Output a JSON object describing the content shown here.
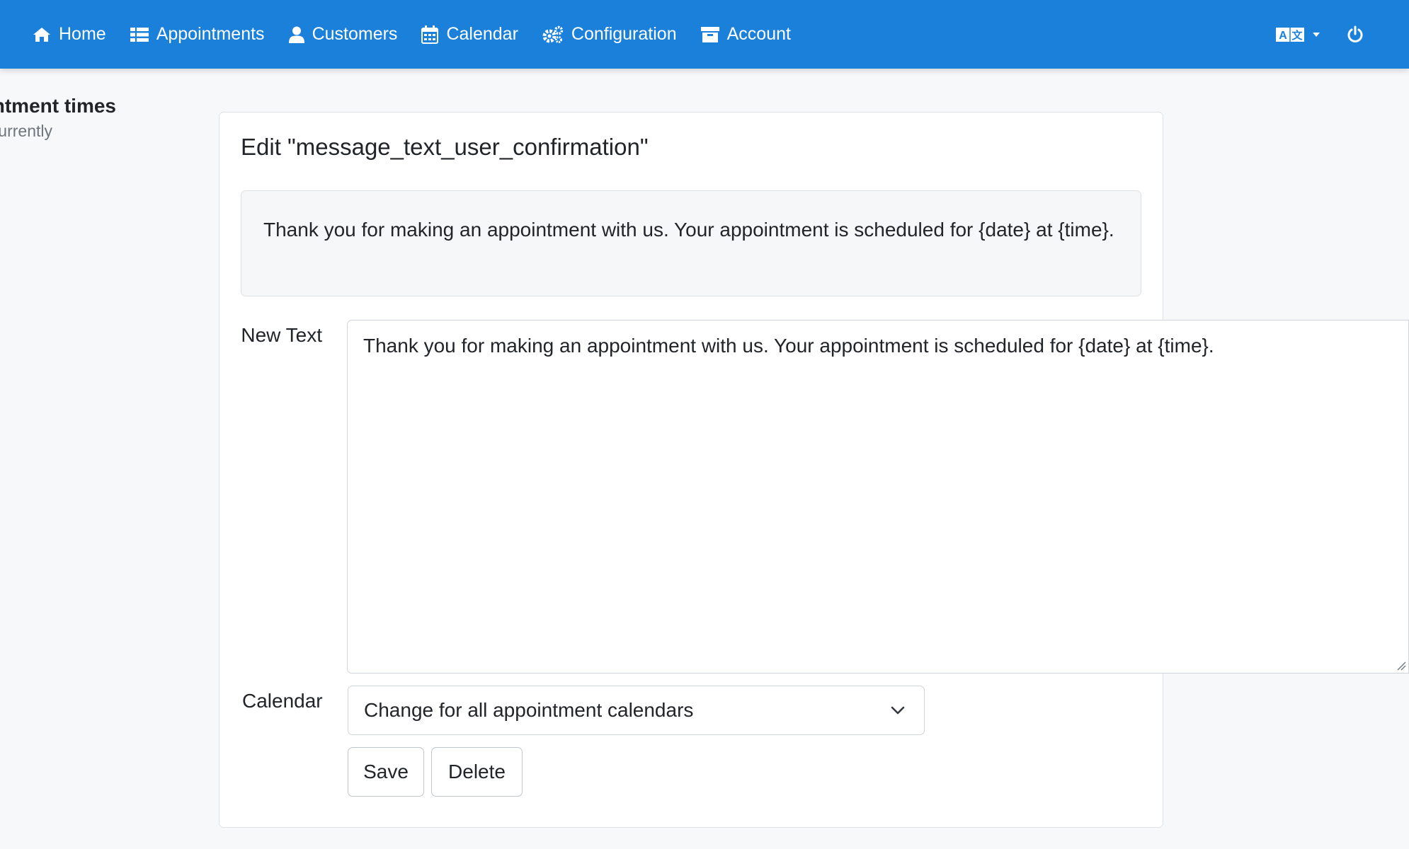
{
  "nav": {
    "items": [
      {
        "label": "Home",
        "icon": "home-icon"
      },
      {
        "label": "Appointments",
        "icon": "list-icon"
      },
      {
        "label": "Customers",
        "icon": "user-icon"
      },
      {
        "label": "Calendar",
        "icon": "calendar-icon"
      },
      {
        "label": "Configuration",
        "icon": "gears-icon"
      },
      {
        "label": "Account",
        "icon": "archive-icon"
      }
    ],
    "language_icon": "translate-icon",
    "power_icon": "power-icon"
  },
  "colors": {
    "navbar": "#1a80da",
    "page_bg": "#f7f8fa",
    "card_bg": "#ffffff"
  },
  "left": {
    "heading": "ntment times",
    "sub": "urrently"
  },
  "card": {
    "title": "Edit \"message_text_user_confirmation\"",
    "current_text": "Thank you for making an appointment with us. Your appointment is scheduled for {date} at {time}."
  },
  "form": {
    "new_text_label": "New Text",
    "new_text_value": "Thank you for making an appointment with us. Your appointment is scheduled for {date} at {time}.",
    "calendar_label": "Calendar",
    "calendar_selected": "Change for all appointment calendars",
    "save_label": "Save",
    "delete_label": "Delete"
  }
}
